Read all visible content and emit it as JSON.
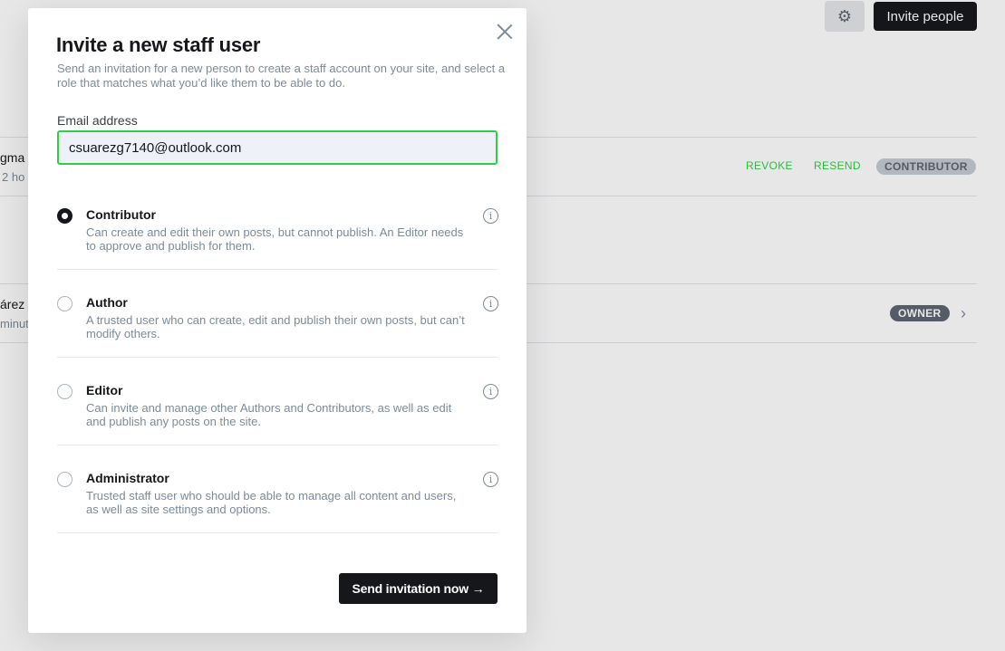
{
  "background": {
    "invite_button": "Invite people",
    "rows": [
      {
        "name": "gma",
        "sub": "2 ho",
        "actions": [
          "REVOKE",
          "RESEND"
        ],
        "badge": "CONTRIBUTOR"
      },
      {
        "name": "árez",
        "sub": "minut",
        "badge": "OWNER"
      }
    ]
  },
  "modal": {
    "title": "Invite a new staff user",
    "description": "Send an invitation for a new person to create a staff account on your site, and select a role that matches what you’d like them to be able to do.",
    "email_label": "Email address",
    "email_value": "csuarezg7140@outlook.com",
    "roles": [
      {
        "name": "Contributor",
        "description": "Can create and edit their own posts, but cannot publish. An Editor needs to approve and publish for them.",
        "checked": true
      },
      {
        "name": "Author",
        "description": "A trusted user who can create, edit and publish their own posts, but can’t modify others.",
        "checked": false
      },
      {
        "name": "Editor",
        "description": "Can invite and manage other Authors and Contributors, as well as edit and publish any posts on the site.",
        "checked": false
      },
      {
        "name": "Administrator",
        "description": "Trusted staff user who should be able to manage all content and users, as well as site settings and options.",
        "checked": false
      }
    ],
    "send_button": "Send invitation now →"
  },
  "icons": {
    "close": "close-icon",
    "info": "info-icon",
    "gear": "gear-icon",
    "chevron": "chevron-right-icon"
  },
  "colors": {
    "accent_green": "#30cf43",
    "dark": "#15171a",
    "muted": "#7c8b9a"
  }
}
